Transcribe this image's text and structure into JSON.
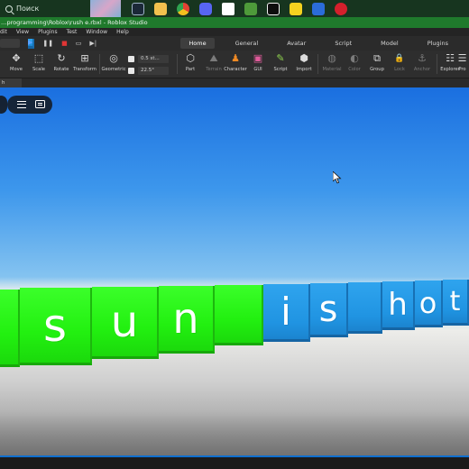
{
  "taskbar": {
    "search_text": "Поиск",
    "icons": [
      {
        "name": "steam-icon",
        "color": "#1b2838"
      },
      {
        "name": "folder-icon",
        "color": "#f2c14e"
      },
      {
        "name": "chrome-icon",
        "color": "#e34133"
      },
      {
        "name": "discord-icon",
        "color": "#5865f2"
      },
      {
        "name": "minecraft-icon",
        "color": "#4e9a3a"
      },
      {
        "name": "roblox-icon",
        "color": "#ffffff"
      },
      {
        "name": "roblox-studio-icon",
        "color": "#f4d21f"
      },
      {
        "name": "app-icon",
        "color": "#2b6cd9"
      },
      {
        "name": "opera-icon",
        "color": "#d4202c"
      }
    ]
  },
  "window": {
    "title": "…programming\\Roblox\\rush e.rbxl - Roblox Studio"
  },
  "menu": [
    "dit",
    "View",
    "Plugins",
    "Test",
    "Window",
    "Help"
  ],
  "tabs": [
    {
      "label": "Home",
      "active": true
    },
    {
      "label": "General",
      "active": false
    },
    {
      "label": "Avatar",
      "active": false
    },
    {
      "label": "Script",
      "active": false
    },
    {
      "label": "Model",
      "active": false
    },
    {
      "label": "Plugins",
      "active": false
    }
  ],
  "toolbar": {
    "tools": [
      {
        "label": "Move",
        "icon": "move-icon",
        "glyph": "✥"
      },
      {
        "label": "Scale",
        "icon": "scale-icon",
        "glyph": "⬚"
      },
      {
        "label": "Rotate",
        "icon": "rotate-icon",
        "glyph": "↻"
      },
      {
        "label": "Transform",
        "icon": "transform-icon",
        "glyph": "⊞"
      },
      {
        "label": "Geometric",
        "icon": "geometric-icon",
        "glyph": "◎"
      },
      {
        "label": "Part",
        "icon": "part-icon",
        "glyph": "⬡"
      },
      {
        "label": "Terrain",
        "icon": "terrain-icon",
        "glyph": "⛰"
      },
      {
        "label": "Character",
        "icon": "character-icon",
        "glyph": "♟"
      },
      {
        "label": "GUI",
        "icon": "gui-icon",
        "glyph": "▣"
      },
      {
        "label": "Script",
        "icon": "script-icon",
        "glyph": "✎"
      },
      {
        "label": "Import",
        "icon": "import-icon",
        "glyph": "⬢"
      },
      {
        "label": "Material",
        "icon": "material-icon",
        "glyph": "◍"
      },
      {
        "label": "Color",
        "icon": "color-icon",
        "glyph": "◐"
      },
      {
        "label": "Group",
        "icon": "group-icon",
        "glyph": "⧉"
      },
      {
        "label": "Lock",
        "icon": "lock-icon",
        "glyph": "🔒"
      },
      {
        "label": "Anchor",
        "icon": "anchor-icon",
        "glyph": "⚓"
      },
      {
        "label": "Explorer",
        "icon": "explorer-icon",
        "glyph": "☷"
      },
      {
        "label": "Pro",
        "icon": "properties-icon",
        "glyph": "☰"
      }
    ],
    "snap_move": "0.5 st...",
    "snap_rotate": "22.5°"
  },
  "document_tab": "h e.rbxl",
  "world_text": {
    "blocks": [
      "s",
      "u",
      "n",
      "i",
      "s",
      "h",
      "o",
      "t"
    ]
  },
  "colors": {
    "green_block": "#2cf51b",
    "blue_block": "#2297e5",
    "title_bar": "#1f7a2c"
  }
}
